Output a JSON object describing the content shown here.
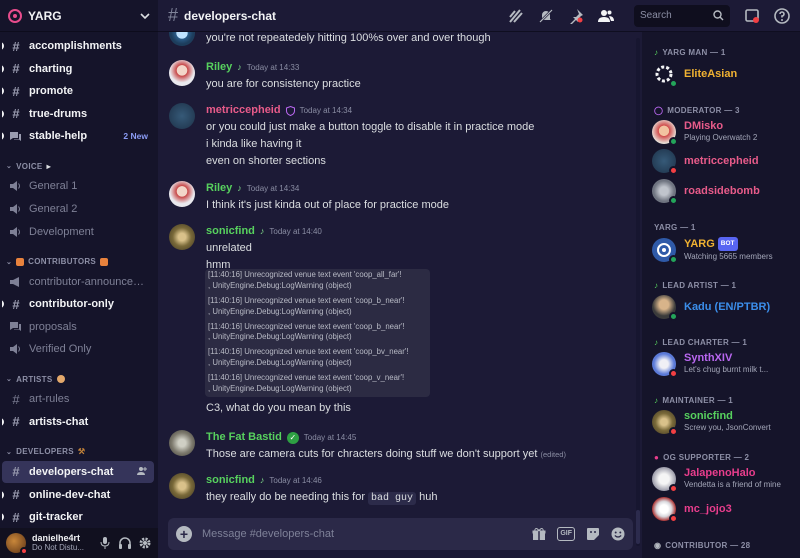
{
  "server": {
    "name": "YARG"
  },
  "sidebar": {
    "channels": [
      {
        "label": "accomplishments",
        "unread": true
      },
      {
        "label": "charting",
        "unread": true
      },
      {
        "label": "promote",
        "unread": true
      },
      {
        "label": "true-drums",
        "unread": true
      },
      {
        "label": "stable-help",
        "unread": true,
        "badge": "2 New"
      }
    ],
    "voice_category": "VOICE",
    "voice": [
      {
        "label": "General 1"
      },
      {
        "label": "General 2"
      },
      {
        "label": "Development"
      }
    ],
    "contributors_category": "CONTRIBUTORS",
    "contributors": [
      {
        "label": "contributor-announcem..."
      },
      {
        "label": "contributor-only",
        "unread": true
      },
      {
        "label": "proposals"
      },
      {
        "label": "Verified Only"
      }
    ],
    "artists_category": "ARTISTS",
    "artists": [
      {
        "label": "art-rules"
      },
      {
        "label": "artists-chat",
        "unread": true
      }
    ],
    "developers_category": "DEVELOPERS",
    "developers": [
      {
        "label": "developers-chat",
        "active": true
      },
      {
        "label": "online-dev-chat",
        "unread": true
      },
      {
        "label": "git-tracker",
        "unread": true
      }
    ]
  },
  "user": {
    "name": "danielhe4rt",
    "status": "Do Not Distu..."
  },
  "header": {
    "channel": "developers-chat",
    "search_placeholder": "Search"
  },
  "messages": [
    {
      "lines": [
        "you're not repeatedely hitting 100%s over and over though"
      ]
    },
    {
      "author": "Riley",
      "color": "#57d15e",
      "time": "Today at 14:33",
      "lines": [
        "you are for consistency practice"
      ]
    },
    {
      "author": "metriccepheid",
      "color": "#e85b8a",
      "time": "Today at 14:34",
      "lines": [
        "or you could just make a button toggle to disable it in practice mode",
        "i kinda like having it",
        "even on shorter sections"
      ]
    },
    {
      "author": "Riley",
      "color": "#57d15e",
      "time": "Today at 14:34",
      "lines": [
        "I think it's just kinda out of place for practice mode"
      ]
    },
    {
      "author": "sonicfind",
      "color": "#57d15e",
      "time": "Today at 14:40",
      "lines": [
        "unrelated",
        "hmm"
      ],
      "after": "C3, what do you mean by this"
    },
    {
      "author": "The Fat Bastid",
      "color": "#57d15e",
      "time": "Today at 14:45",
      "lines": [
        "Those are camera cuts for chracters doing stuff we don't support yet"
      ],
      "edited": "(edited)"
    },
    {
      "author": "sonicfind",
      "color": "#57d15e",
      "time": "Today at 14:46",
      "line_pre": "they really do be needing this for ",
      "code": "bad guy",
      "line_post": " huh"
    }
  ],
  "log_entries": [
    {
      "l1": "[11:40:16] Unrecognized venue text event 'coop_all_far'!",
      "l2": ", UnityEngine.Debug:LogWarning (object)"
    },
    {
      "l1": "[11:40:16] Unrecognized venue text event 'coop_b_near'!",
      "l2": ", UnityEngine.Debug:LogWarning (object)"
    },
    {
      "l1": "[11:40:16] Unrecognized venue text event 'coop_b_near'!",
      "l2": ", UnityEngine.Debug:LogWarning (object)"
    },
    {
      "l1": "[11:40:16] Unrecognized venue text event 'coop_bv_near'!",
      "l2": ", UnityEngine.Debug:LogWarning (object)"
    },
    {
      "l1": "[11:40:16] Unrecognized venue text event 'coop_v_near'!",
      "l2": ", UnityEngine.Debug:LogWarning (object)"
    }
  ],
  "composer": {
    "placeholder": "Message #developers-chat"
  },
  "members": {
    "roles": [
      {
        "label": "YARG MAN — 1"
      },
      {
        "label": "MODERATOR — 3"
      },
      {
        "label": "YARG — 1"
      },
      {
        "label": "LEAD ARTIST — 1"
      },
      {
        "label": "LEAD CHARTER — 1"
      },
      {
        "label": "MAINTAINER — 1"
      },
      {
        "label": "OG SUPPORTER — 2"
      },
      {
        "label": "CONTRIBUTOR — 28"
      }
    ],
    "list": [
      {
        "name": "EliteAsian",
        "color": "#f0b232",
        "status": "online"
      },
      {
        "name": "DMisko",
        "color": "#e85b8a",
        "activity": "Playing Overwatch 2",
        "status": "online"
      },
      {
        "name": "metriccepheid",
        "color": "#e85b8a",
        "status": "dnd"
      },
      {
        "name": "roadsidebomb",
        "color": "#e85b8a",
        "status": "online"
      },
      {
        "name": "YARG",
        "color": "#f0b232",
        "bot": "BOT",
        "activity": "Watching 5665 members",
        "status": "online"
      },
      {
        "name": "Kadu (EN/PTBR)",
        "color": "#3b8eea",
        "status": "online"
      },
      {
        "name": "SynthXIV",
        "color": "#b967f0",
        "activity": "Let's chug burnt milk t...",
        "status": "dnd"
      },
      {
        "name": "sonicfind",
        "color": "#57d15e",
        "activity": "Screw you, JsonConvert",
        "status": "dnd"
      },
      {
        "name": "JalapenoHalo",
        "color": "#e83d8c",
        "activity": "Vendetta is a friend of mine",
        "status": "dnd"
      },
      {
        "name": "mc_jojo3",
        "color": "#e83d8c",
        "status": "dnd"
      }
    ]
  }
}
